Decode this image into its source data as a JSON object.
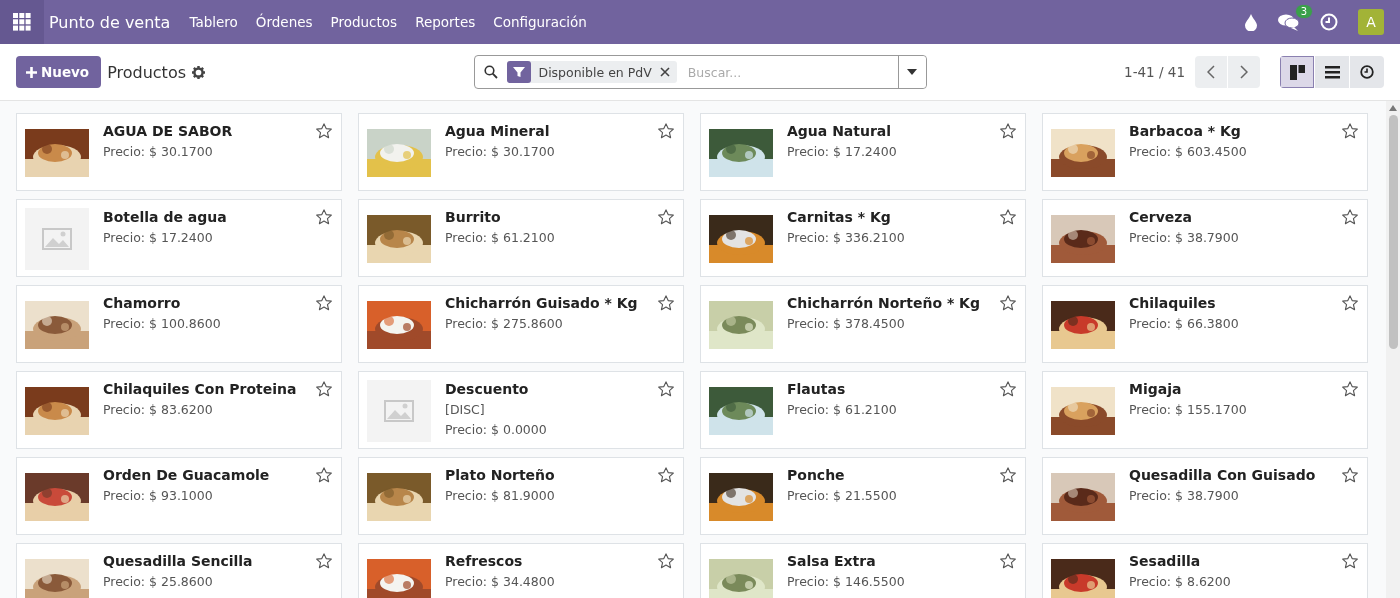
{
  "navbar": {
    "app_name": "Punto de venta",
    "menu": [
      "Tablero",
      "Órdenes",
      "Productos",
      "Reportes",
      "Configuración"
    ],
    "messages_badge": "3",
    "avatar": "A"
  },
  "control_panel": {
    "new_button": "Nuevo",
    "title": "Productos",
    "search": {
      "facet": "Disponible en PdV",
      "placeholder": "Buscar..."
    },
    "pager": "1-41 / 41",
    "views": [
      {
        "kind": "kanban",
        "selected": true
      },
      {
        "kind": "list",
        "selected": false
      },
      {
        "kind": "activity",
        "selected": false
      }
    ]
  },
  "products": [
    {
      "name": "AGUA DE SABOR",
      "price": "Precio: $ 30.1700"
    },
    {
      "name": "Agua Mineral",
      "price": "Precio: $ 30.1700"
    },
    {
      "name": "Agua Natural",
      "price": "Precio: $ 17.2400"
    },
    {
      "name": "Barbacoa * Kg",
      "price": "Precio: $ 603.4500"
    },
    {
      "name": "Botella de agua",
      "price": "Precio: $ 17.2400",
      "kind": "placeholder"
    },
    {
      "name": "Burrito",
      "price": "Precio: $ 61.2100"
    },
    {
      "name": "Carnitas * Kg",
      "price": "Precio: $ 336.2100"
    },
    {
      "name": "Cerveza",
      "price": "Precio: $ 38.7900"
    },
    {
      "name": "Chamorro",
      "price": "Precio: $ 100.8600"
    },
    {
      "name": "Chicharrón Guisado * Kg",
      "price": "Precio: $ 275.8600"
    },
    {
      "name": "Chicharrón Norteño * Kg",
      "price": "Precio: $ 378.4500"
    },
    {
      "name": "Chilaquiles",
      "price": "Precio: $ 66.3800"
    },
    {
      "name": "Chilaquiles Con Proteina",
      "price": "Precio: $ 83.6200"
    },
    {
      "name": "Descuento",
      "code": "[DISC]",
      "price": "Precio: $ 0.0000",
      "kind": "placeholder"
    },
    {
      "name": "Flautas",
      "price": "Precio: $ 61.2100"
    },
    {
      "name": "Migaja",
      "price": "Precio: $ 155.1700"
    },
    {
      "name": "Orden De Guacamole",
      "price": "Precio: $ 93.1000"
    },
    {
      "name": "Plato Norteño",
      "price": "Precio: $ 81.9000"
    },
    {
      "name": "Ponche",
      "price": "Precio: $ 21.5500"
    },
    {
      "name": "Quesadilla Con Guisado",
      "price": "Precio: $ 38.7900"
    },
    {
      "name": "Quesadilla Sencilla",
      "price": "Precio: $ 25.8600"
    },
    {
      "name": "Refrescos",
      "price": "Precio: $ 34.4800"
    },
    {
      "name": "Salsa Extra",
      "price": "Precio: $ 146.5500"
    },
    {
      "name": "Sesadilla",
      "price": "Precio: $ 8.6200"
    }
  ]
}
